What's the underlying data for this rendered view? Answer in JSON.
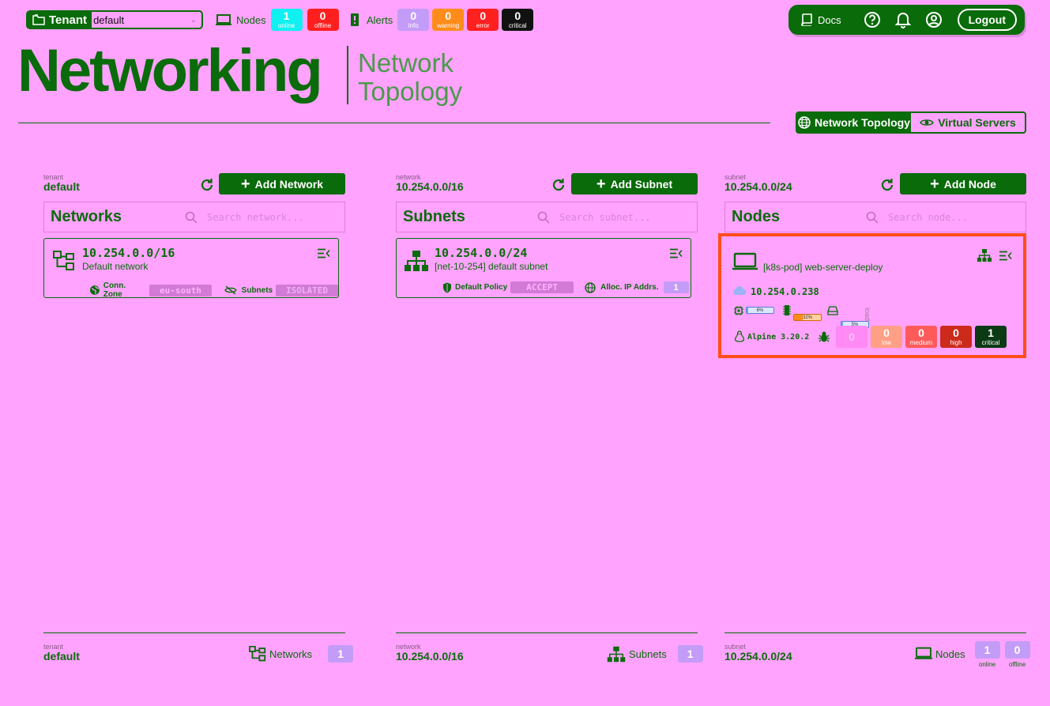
{
  "header": {
    "tenant_label": "Tenant",
    "tenant_value": "default",
    "nodes_label": "Nodes",
    "nodes_online": "1",
    "nodes_online_label": "online",
    "nodes_offline": "0",
    "nodes_offline_label": "offline",
    "alerts_label": "Alerts",
    "alerts_info": "0",
    "alerts_info_label": "info",
    "alerts_warning": "0",
    "alerts_warning_label": "warning",
    "alerts_error": "0",
    "alerts_error_label": "error",
    "alerts_critical": "0",
    "alerts_critical_label": "critical",
    "docs_label": "Docs",
    "logout_label": "Logout"
  },
  "page": {
    "title": "Networking",
    "subtitle_line1": "Network",
    "subtitle_line2": "Topology"
  },
  "view_toggle": {
    "topology": "Network Topology",
    "virtual_servers": "Virtual Servers"
  },
  "columns": {
    "networks": {
      "ctx_label": "tenant",
      "ctx_value": "default",
      "add_label": "Add Network",
      "panel_title": "Networks",
      "search_placeholder": "Search network...",
      "card": {
        "title": "10.254.0.0/16",
        "subtitle": "Default network",
        "zone_label": "Conn. Zone",
        "zone_value": "eu-south",
        "subnets_label": "Subnets",
        "subnets_value": "ISOLATED"
      },
      "footer_ctx_label": "tenant",
      "footer_ctx_value": "default",
      "footer_label": "Networks",
      "footer_count": "1"
    },
    "subnets": {
      "ctx_label": "network",
      "ctx_value": "10.254.0.0/16",
      "add_label": "Add Subnet",
      "panel_title": "Subnets",
      "search_placeholder": "Search subnet...",
      "card": {
        "title": "10.254.0.0/24",
        "subtitle": "[net-10-254] default subnet",
        "policy_label": "Default Policy",
        "policy_value": "ACCEPT",
        "alloc_label": "Alloc. IP Addrs.",
        "alloc_value": "1"
      },
      "footer_ctx_label": "network",
      "footer_ctx_value": "10.254.0.0/16",
      "footer_label": "Subnets",
      "footer_count": "1"
    },
    "nodes": {
      "ctx_label": "subnet",
      "ctx_value": "10.254.0.0/24",
      "add_label": "Add Node",
      "panel_title": "Nodes",
      "search_placeholder": "Search node...",
      "card": {
        "name": "[k8s-pod] web-server-deploy",
        "ip": "10.254.0.238",
        "cpu_pct": "6%",
        "cpu_fill": 6,
        "mem_pct": "32%",
        "mem_fill": 32,
        "disk_pct": "5%",
        "disk_fill": 5,
        "load_label": "load",
        "os": "Alpine 3.20.2",
        "vuln_unknown": "0",
        "vuln_low": "0",
        "vuln_low_label": "low",
        "vuln_medium": "0",
        "vuln_medium_label": "medium",
        "vuln_high": "0",
        "vuln_high_label": "high",
        "vuln_critical": "1",
        "vuln_critical_label": "critical"
      },
      "footer_ctx_label": "subnet",
      "footer_ctx_value": "10.254.0.0/24",
      "footer_label": "Nodes",
      "footer_online": "1",
      "footer_online_label": "online",
      "footer_offline": "0",
      "footer_offline_label": "offline"
    }
  },
  "colors": {
    "background": "#ffa3ff",
    "primary": "#0a6b0a",
    "highlight": "#ff4d1a"
  }
}
